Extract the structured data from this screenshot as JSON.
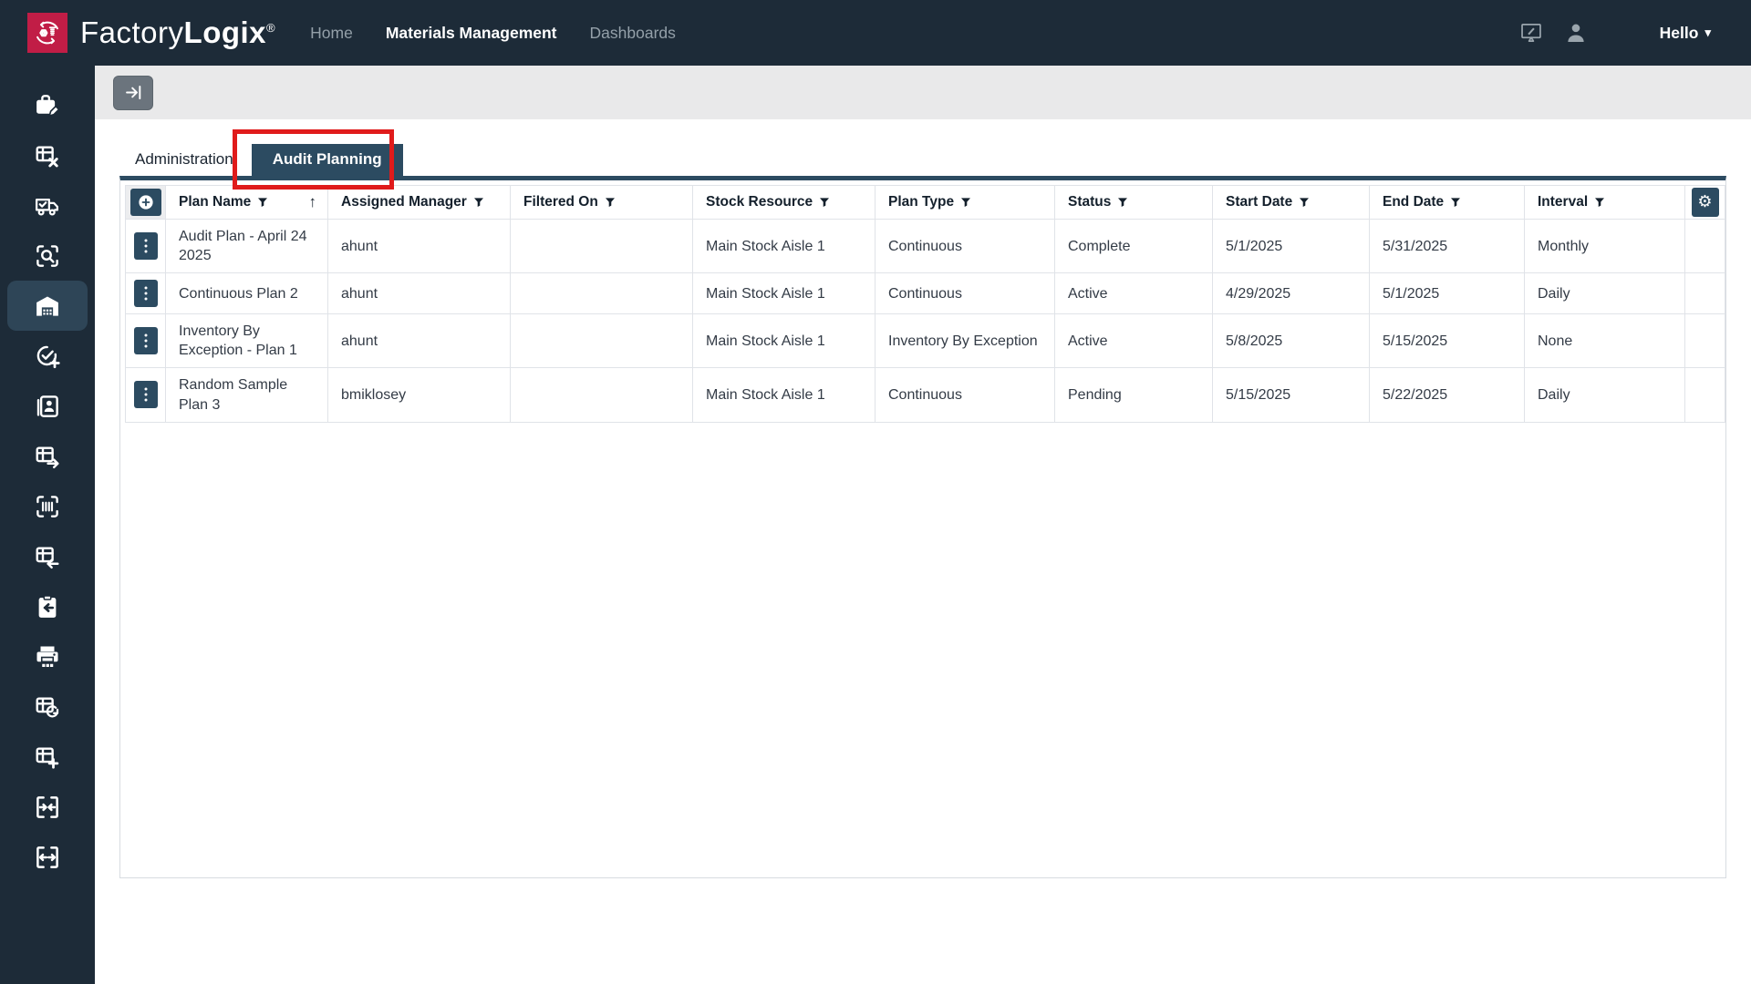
{
  "navbar": {
    "brand": {
      "factory": "Factory",
      "logix": "Logix",
      "registered": "®"
    },
    "links": [
      {
        "label": "Home",
        "active": false
      },
      {
        "label": "Materials Management",
        "active": true
      },
      {
        "label": "Dashboards",
        "active": false
      }
    ],
    "user_menu": {
      "label": "Hello"
    }
  },
  "sidebar": {
    "items": [
      {
        "icon": "briefcase-edit",
        "active": false
      },
      {
        "icon": "table-remove",
        "active": false
      },
      {
        "icon": "truck-check",
        "active": false
      },
      {
        "icon": "search-scan",
        "active": false
      },
      {
        "icon": "warehouse",
        "active": true
      },
      {
        "icon": "check-circle-add",
        "active": false
      },
      {
        "icon": "contact-card",
        "active": false
      },
      {
        "icon": "table-export-right",
        "active": false
      },
      {
        "icon": "barcode-scan",
        "active": false
      },
      {
        "icon": "table-import-left",
        "active": false
      },
      {
        "icon": "clipboard-return",
        "active": false
      },
      {
        "icon": "printer",
        "active": false
      },
      {
        "icon": "table-refresh",
        "active": false
      },
      {
        "icon": "table-add",
        "active": false
      },
      {
        "icon": "collapse-horizontal",
        "active": false
      },
      {
        "icon": "expand-horizontal",
        "active": false
      }
    ]
  },
  "toolbar": {
    "collapse_panel_icon": "arrow-to-bar"
  },
  "tabs": [
    {
      "label": "Administration",
      "active": false
    },
    {
      "label": "Audit Planning",
      "active": true
    }
  ],
  "annotation": {
    "shape": "rectangle",
    "color": "#e01b1b",
    "target": "audit-planning-tab"
  },
  "table": {
    "expand_all_icon": "circle-plus",
    "settings_icon": "gear",
    "columns": [
      {
        "label": "Plan Name",
        "filterable": true,
        "sorted": "asc"
      },
      {
        "label": "Assigned Manager",
        "filterable": true
      },
      {
        "label": "Filtered On",
        "filterable": true
      },
      {
        "label": "Stock Resource",
        "filterable": true
      },
      {
        "label": "Plan Type",
        "filterable": true
      },
      {
        "label": "Status",
        "filterable": true
      },
      {
        "label": "Start Date",
        "filterable": true
      },
      {
        "label": "End Date",
        "filterable": true
      },
      {
        "label": "Interval",
        "filterable": true
      }
    ],
    "row_fields": [
      "plan_name",
      "assigned_manager",
      "filtered_on",
      "stock_resource",
      "plan_type",
      "status",
      "start_date",
      "end_date",
      "interval"
    ],
    "rows": [
      {
        "plan_name": "Audit Plan - April 24 2025",
        "assigned_manager": "ahunt",
        "filtered_on": "",
        "stock_resource": "Main Stock Aisle 1",
        "plan_type": "Continuous",
        "status": "Complete",
        "start_date": "5/1/2025",
        "end_date": "5/31/2025",
        "interval": "Monthly"
      },
      {
        "plan_name": "Continuous Plan 2",
        "assigned_manager": "ahunt",
        "filtered_on": "",
        "stock_resource": "Main Stock Aisle 1",
        "plan_type": "Continuous",
        "status": "Active",
        "start_date": "4/29/2025",
        "end_date": "5/1/2025",
        "interval": "Daily"
      },
      {
        "plan_name": "Inventory By Exception - Plan 1",
        "assigned_manager": "ahunt",
        "filtered_on": "",
        "stock_resource": "Main Stock Aisle 1",
        "plan_type": "Inventory By Exception",
        "status": "Active",
        "start_date": "5/8/2025",
        "end_date": "5/15/2025",
        "interval": "None"
      },
      {
        "plan_name": "Random Sample Plan 3",
        "assigned_manager": "bmiklosey",
        "filtered_on": "",
        "stock_resource": "Main Stock Aisle 1",
        "plan_type": "Continuous",
        "status": "Pending",
        "start_date": "5/15/2025",
        "end_date": "5/22/2025",
        "interval": "Daily"
      }
    ]
  },
  "icons": {
    "gear": "⚙",
    "sort_ascending": "↑",
    "caret_down": "▾"
  },
  "colors": {
    "navbar_bg": "#1d2b38",
    "brand_red": "#c11d46",
    "accent_navy": "#2c4b61",
    "annotation_red": "#e01b1b",
    "sidebar_active_bg": "#2e4557",
    "strip_gray": "#e9e9ea",
    "button_gray": "#6b747d"
  }
}
